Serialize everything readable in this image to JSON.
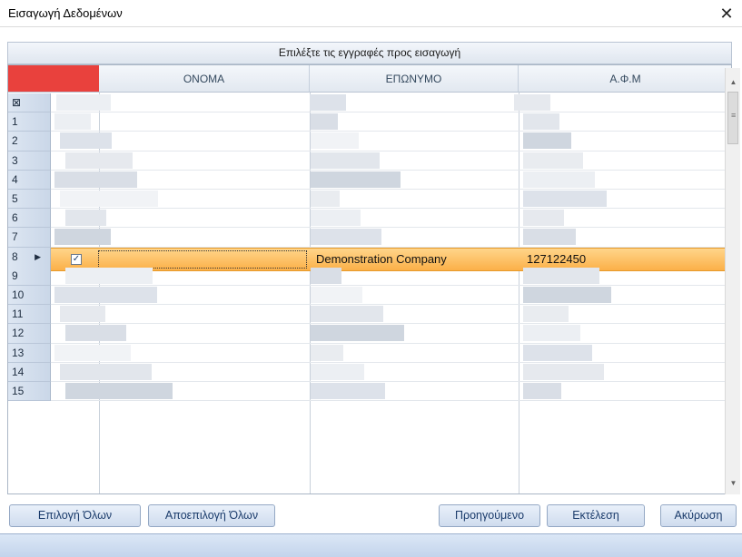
{
  "window": {
    "title": "Εισαγωγή Δεδομένων",
    "close_glyph": "✕"
  },
  "caption": "Επιλέξτε τις εγγραφές προς εισαγωγή",
  "grid": {
    "columns": [
      "ΟΝΟΜΑ",
      "ΕΠΩΝΥΜΟ",
      "Α.Φ.Μ"
    ],
    "corner_color": "#e9413d",
    "header_row_icon": "filter-icon",
    "row_numbers": [
      "1",
      "2",
      "3",
      "4",
      "5",
      "6",
      "7",
      "8",
      "9",
      "10",
      "11",
      "12",
      "13",
      "14",
      "15"
    ],
    "selected_row": {
      "number": "8",
      "checked": true,
      "checkbox_glyph": "✓",
      "arrow_glyph": "▶",
      "onoma": "",
      "eponymo": "Demonstration Company",
      "afm": "127122450"
    }
  },
  "scrollbar": {
    "up_glyph": "▲",
    "down_glyph": "▼",
    "grip_glyph": "≡"
  },
  "buttons": {
    "select_all": "Επιλογή Όλων",
    "deselect_all": "Αποεπιλογή Όλων",
    "previous": "Προηγούμενο",
    "execute": "Εκτέλεση",
    "cancel": "Ακύρωση"
  },
  "colors": {
    "selection": "#fbb048",
    "accent": "#1a3b6b"
  }
}
